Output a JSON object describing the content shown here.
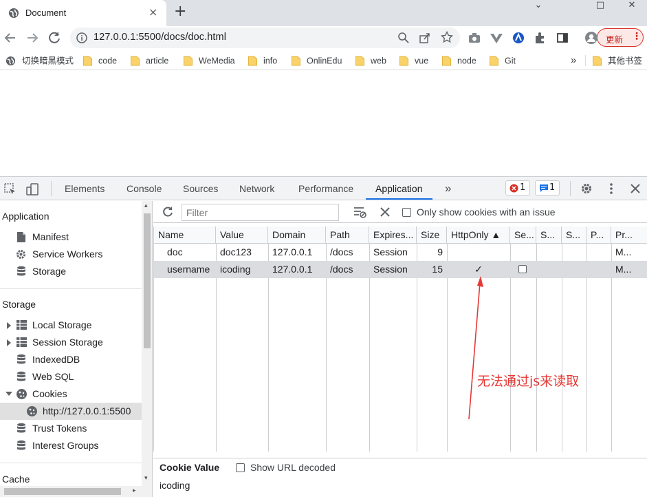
{
  "browser": {
    "tab_title": "Document",
    "tab_close": "×",
    "new_tab": "+",
    "window_controls": {
      "minimize": "⌄",
      "restore": "□",
      "close": "✕"
    },
    "url": "127.0.0.1:5500/docs/doc.html",
    "update_label": "更新",
    "update_menu": "⋮",
    "bookmarks": [
      {
        "label": "切换暗黑模式",
        "icon": "globe-icon"
      },
      {
        "label": "code",
        "icon": "folder-icon"
      },
      {
        "label": "article",
        "icon": "folder-icon"
      },
      {
        "label": "WeMedia",
        "icon": "folder-icon"
      },
      {
        "label": "info",
        "icon": "folder-icon"
      },
      {
        "label": "OnlinEdu",
        "icon": "folder-icon"
      },
      {
        "label": "web",
        "icon": "folder-icon"
      },
      {
        "label": "vue",
        "icon": "folder-icon"
      },
      {
        "label": "node",
        "icon": "folder-icon"
      },
      {
        "label": "Git",
        "icon": "folder-icon"
      }
    ],
    "bookmarks_overflow": "»",
    "other_bookmarks": "其他书签"
  },
  "devtools": {
    "tabs": [
      "Elements",
      "Console",
      "Sources",
      "Network",
      "Performance",
      "Application"
    ],
    "active_tab": "Application",
    "more_tabs": "»",
    "error_count": "1",
    "message_count": "1",
    "sidebar": {
      "application_header": "Application",
      "application_items": [
        "Manifest",
        "Service Workers",
        "Storage"
      ],
      "storage_header": "Storage",
      "storage_items": [
        "Local Storage",
        "Session Storage",
        "IndexedDB",
        "Web SQL",
        "Cookies"
      ],
      "cookie_origin": "http://127.0.0.1:5500",
      "extra_items": [
        "Trust Tokens",
        "Interest Groups"
      ],
      "cache_header": "Cache"
    },
    "toolbar": {
      "filter_placeholder": "Filter",
      "only_issue_label": "Only show cookies with an issue"
    },
    "table": {
      "columns": [
        "Name",
        "Value",
        "Domain",
        "Path",
        "Expires...",
        "Size",
        "HttpOnly ▲",
        "Se...",
        "S...",
        "S...",
        "P...",
        "Pr..."
      ],
      "rows": [
        {
          "name": "doc",
          "value": "doc123",
          "domain": "127.0.0.1",
          "path": "/docs",
          "expires": "Session",
          "size": "9",
          "httponly": "",
          "priority": "M..."
        },
        {
          "name": "username",
          "value": "icoding",
          "domain": "127.0.0.1",
          "path": "/docs",
          "expires": "Session",
          "size": "15",
          "httponly": "✓",
          "priority": "M..."
        }
      ]
    },
    "annotation": "无法通过js来读取",
    "value_pane": {
      "title": "Cookie Value",
      "show_decoded_label": "Show URL decoded",
      "value": "icoding"
    }
  },
  "colors": {
    "accent": "#1a73e8",
    "annotation": "#e53935",
    "selected_row": "#dadce0",
    "update_border": "#d93025"
  }
}
